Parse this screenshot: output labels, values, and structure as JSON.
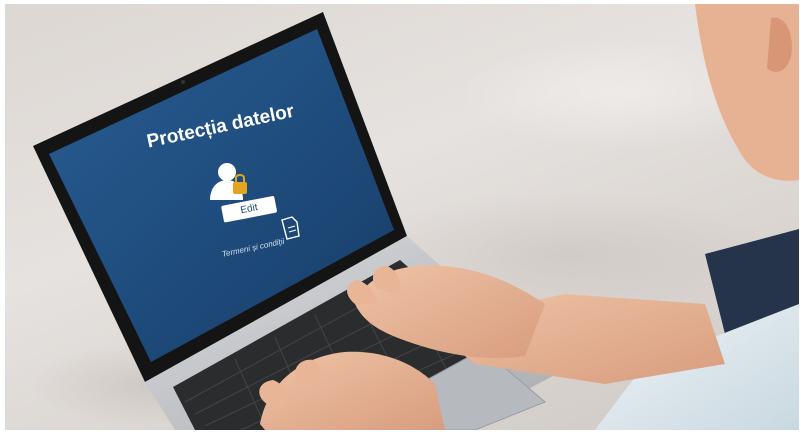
{
  "screen": {
    "title": "Protecția datelor",
    "button_label": "Edit",
    "link_label": "Termeni și condiții"
  },
  "icons": {
    "user": "user-lock-icon",
    "document": "document-icon"
  },
  "colors": {
    "screen_blue": "#1f4d7e",
    "lock_gold": "#e3a422",
    "shirt": "#dfe9ee",
    "jeans": "#25344b",
    "laptop_silver": "#c7c9cc",
    "background_fabric": "#dcd7d3"
  }
}
